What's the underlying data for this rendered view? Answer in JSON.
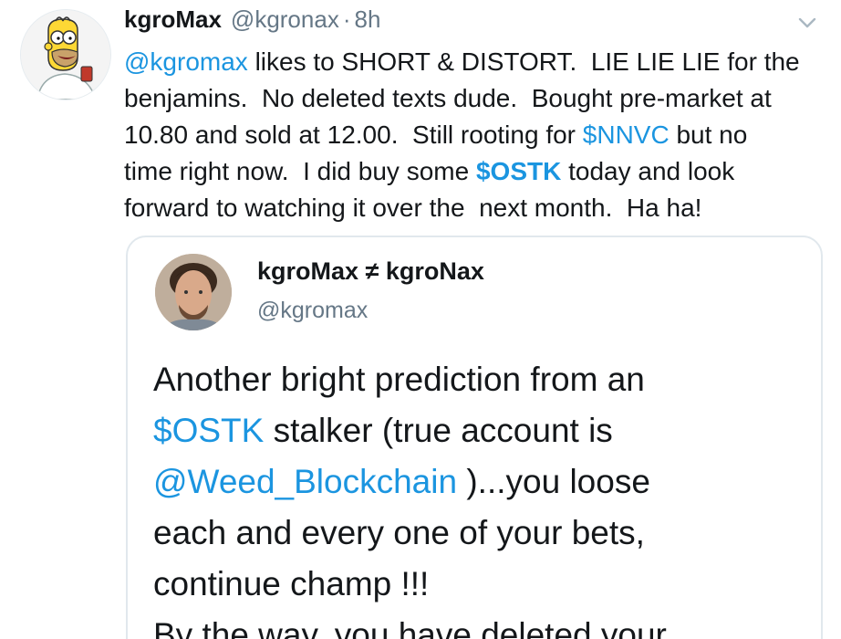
{
  "tweet": {
    "display_name": "kgroMax",
    "handle": "@kgronax",
    "separator": "·",
    "timestamp": "8h",
    "text_lines": [
      [
        {
          "t": "@kgromax",
          "k": "link"
        },
        {
          "t": " likes to SHORT & DISTORT.  LIE LIE LIE for the",
          "k": "plain"
        }
      ],
      [
        {
          "t": "benjamins.  No deleted texts dude.  Bought pre-market at",
          "k": "plain"
        }
      ],
      [
        {
          "t": "10.80 and sold at 12.00.  Still rooting for ",
          "k": "plain"
        },
        {
          "t": "$NNVC",
          "k": "link"
        },
        {
          "t": " but no",
          "k": "plain"
        }
      ],
      [
        {
          "t": "time right now.  I did buy some ",
          "k": "plain"
        },
        {
          "t": "$OSTK",
          "k": "cash"
        },
        {
          "t": " today and look",
          "k": "plain"
        }
      ],
      [
        {
          "t": "forward to watching it over the  next month.  Ha ha!",
          "k": "plain"
        }
      ]
    ]
  },
  "quoted_tweet": {
    "display_name": "kgroMax ≠ kgroNax",
    "handle": "@kgromax",
    "text_lines": [
      [
        {
          "t": "Another bright prediction from an",
          "k": "plain"
        }
      ],
      [
        {
          "t": "$OSTK",
          "k": "link"
        },
        {
          "t": " stalker (true account is",
          "k": "plain"
        }
      ],
      [
        {
          "t": "@Weed_Blockchain",
          "k": "link"
        },
        {
          "t": " )...you loose",
          "k": "plain"
        }
      ],
      [
        {
          "t": "each and every one of your bets,",
          "k": "plain"
        }
      ],
      [
        {
          "t": "continue champ !!!",
          "k": "plain"
        }
      ],
      [
        {
          "t": "By the way, you have deleted your",
          "k": "plain"
        }
      ]
    ]
  },
  "icons": {
    "avatar": "cartoon-avatar-icon",
    "caret": "chevron-down-icon",
    "quoted_avatar": "profile-photo-avatar"
  },
  "colors": {
    "link": "#1b95e0",
    "secondary": "#657786",
    "border": "#e1e8ed",
    "text": "#14171a"
  }
}
